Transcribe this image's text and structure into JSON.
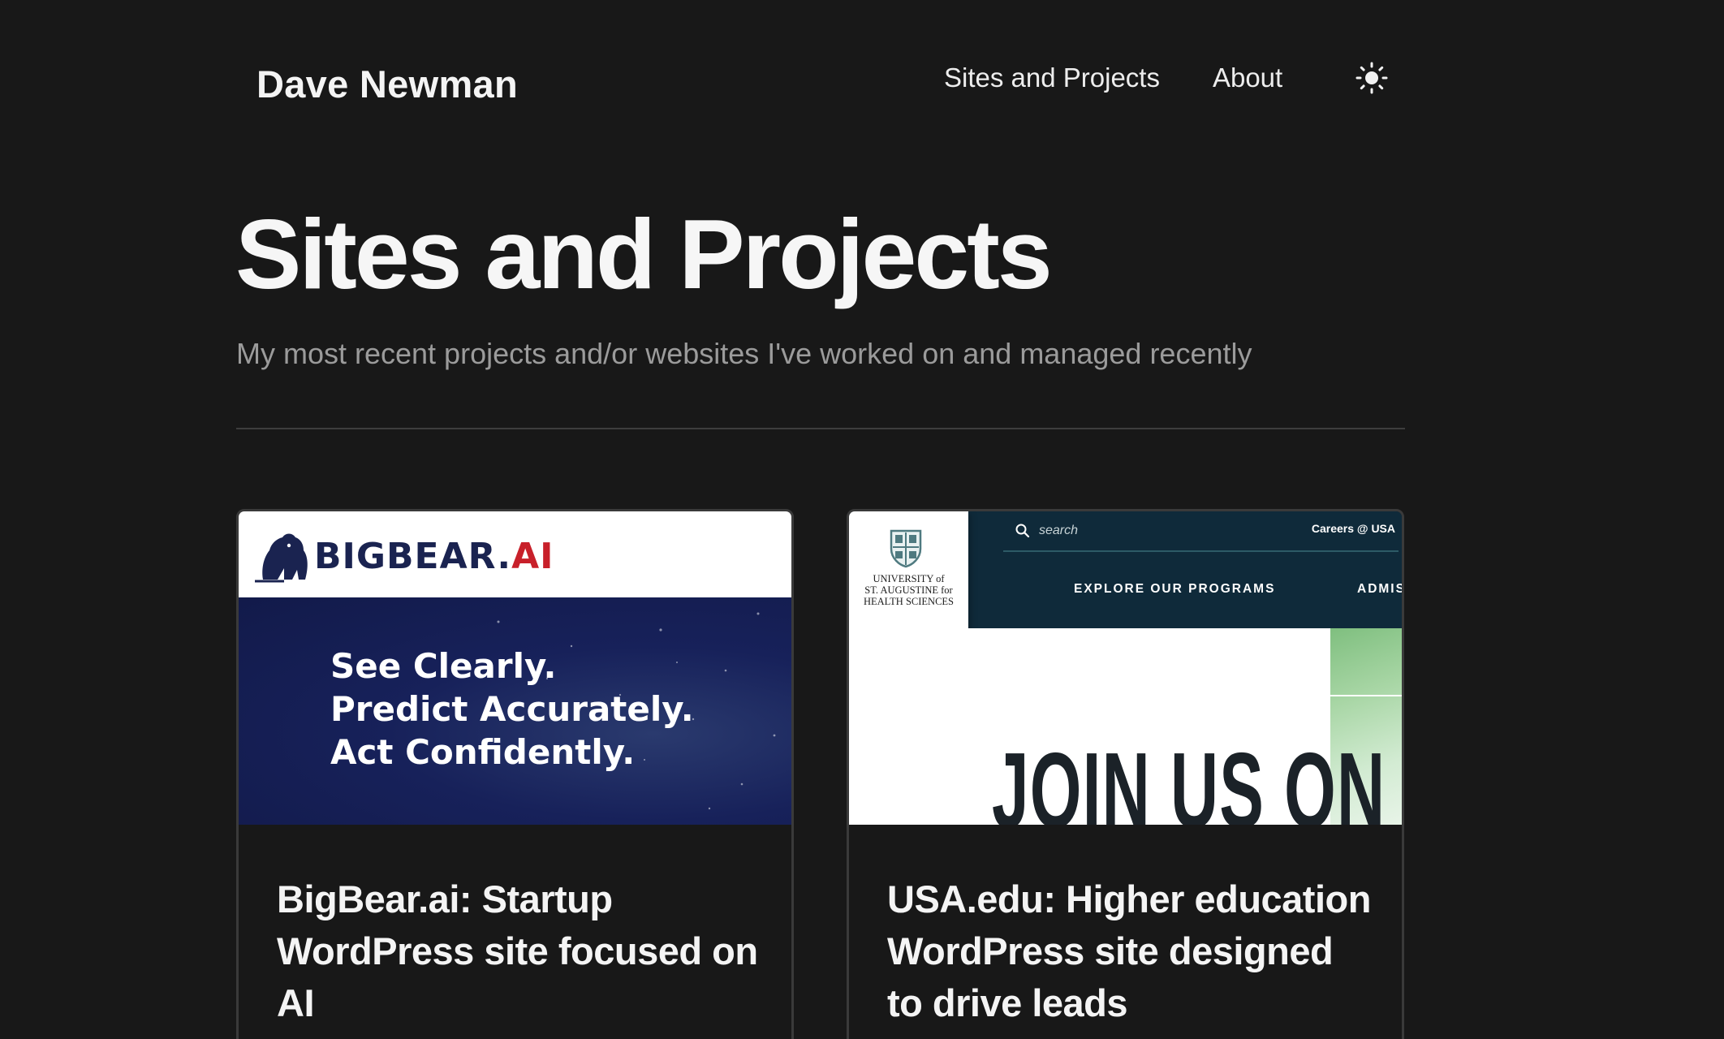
{
  "header": {
    "site_title": "Dave Newman",
    "nav": {
      "projects": "Sites and Projects",
      "about": "About"
    },
    "theme_toggle_icon": "sun-icon"
  },
  "hero": {
    "title": "Sites and Projects",
    "subtitle": "My most recent projects and/or websites I've worked on and managed recently"
  },
  "cards": [
    {
      "title": "BigBear.ai: Startup WordPress site focused on AI",
      "thumbnail": {
        "logo_main": "BIGBEAR.",
        "logo_accent": "AI",
        "headline_1": "See Clearly.",
        "headline_2": "Predict Accurately.",
        "headline_3": "Act Confidently."
      }
    },
    {
      "title": "USA.edu: Higher education WordPress site designed to drive leads",
      "thumbnail": {
        "logo_line1": "UNIVERSITY of",
        "logo_line2": "ST. AUGUSTINE for",
        "logo_line3": "HEALTH SCIENCES",
        "search_placeholder": "search",
        "careers": "Careers @ USA",
        "menu_explore": "EXPLORE OUR PROGRAMS",
        "menu_admissions": "ADMIS",
        "hero_text": "JOIN US ON THE"
      }
    }
  ],
  "colors": {
    "background": "#181818",
    "text": "#f4f4f4",
    "muted": "#9b9b9b",
    "bigbear_navy": "#1a2350",
    "bigbear_red": "#c8202a",
    "usa_navy": "#0f2a3a"
  }
}
